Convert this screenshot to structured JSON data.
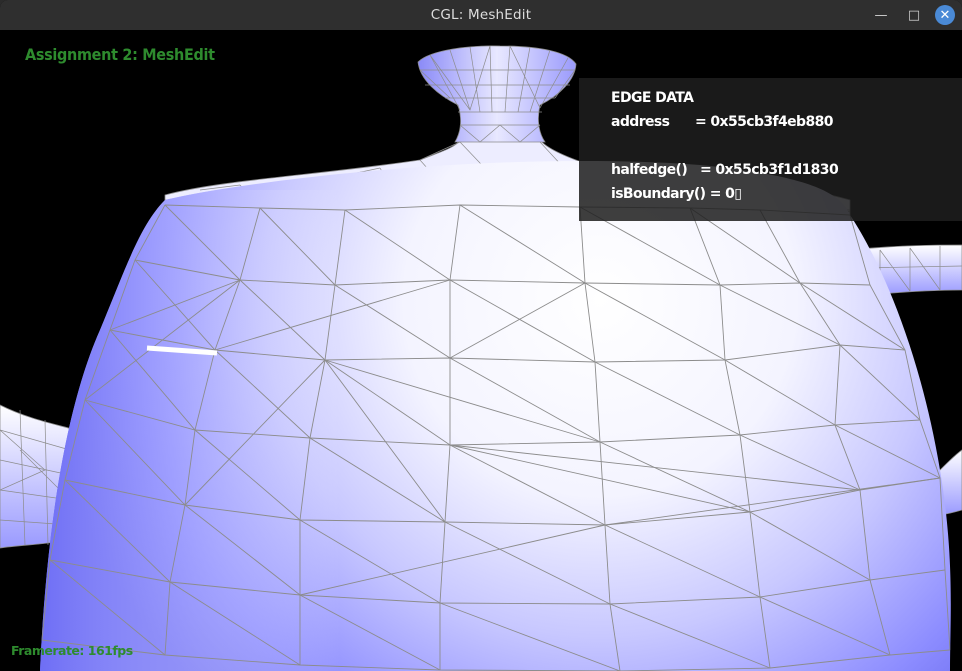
{
  "window": {
    "title": "CGL: MeshEdit",
    "minimize_icon": "minimize-icon",
    "maximize_icon": "maximize-icon",
    "close_icon": "close-icon"
  },
  "overlay": {
    "heading": "Assignment 2: MeshEdit",
    "framerate": "Framerate: 161fps"
  },
  "edge_panel": {
    "title": "EDGE DATA",
    "rows": [
      "address      = 0x55cb3f4eb880",
      "",
      "halfedge()   = 0x55cb3f1d1830",
      "isBoundary() = 0▯"
    ]
  },
  "colors": {
    "mesh_base": "#7a7aff",
    "mesh_highlight": "#ffffff",
    "wire": "#8c8c8c",
    "selected_edge": "#ffffff",
    "overlay_text": "#2e8b2e"
  }
}
